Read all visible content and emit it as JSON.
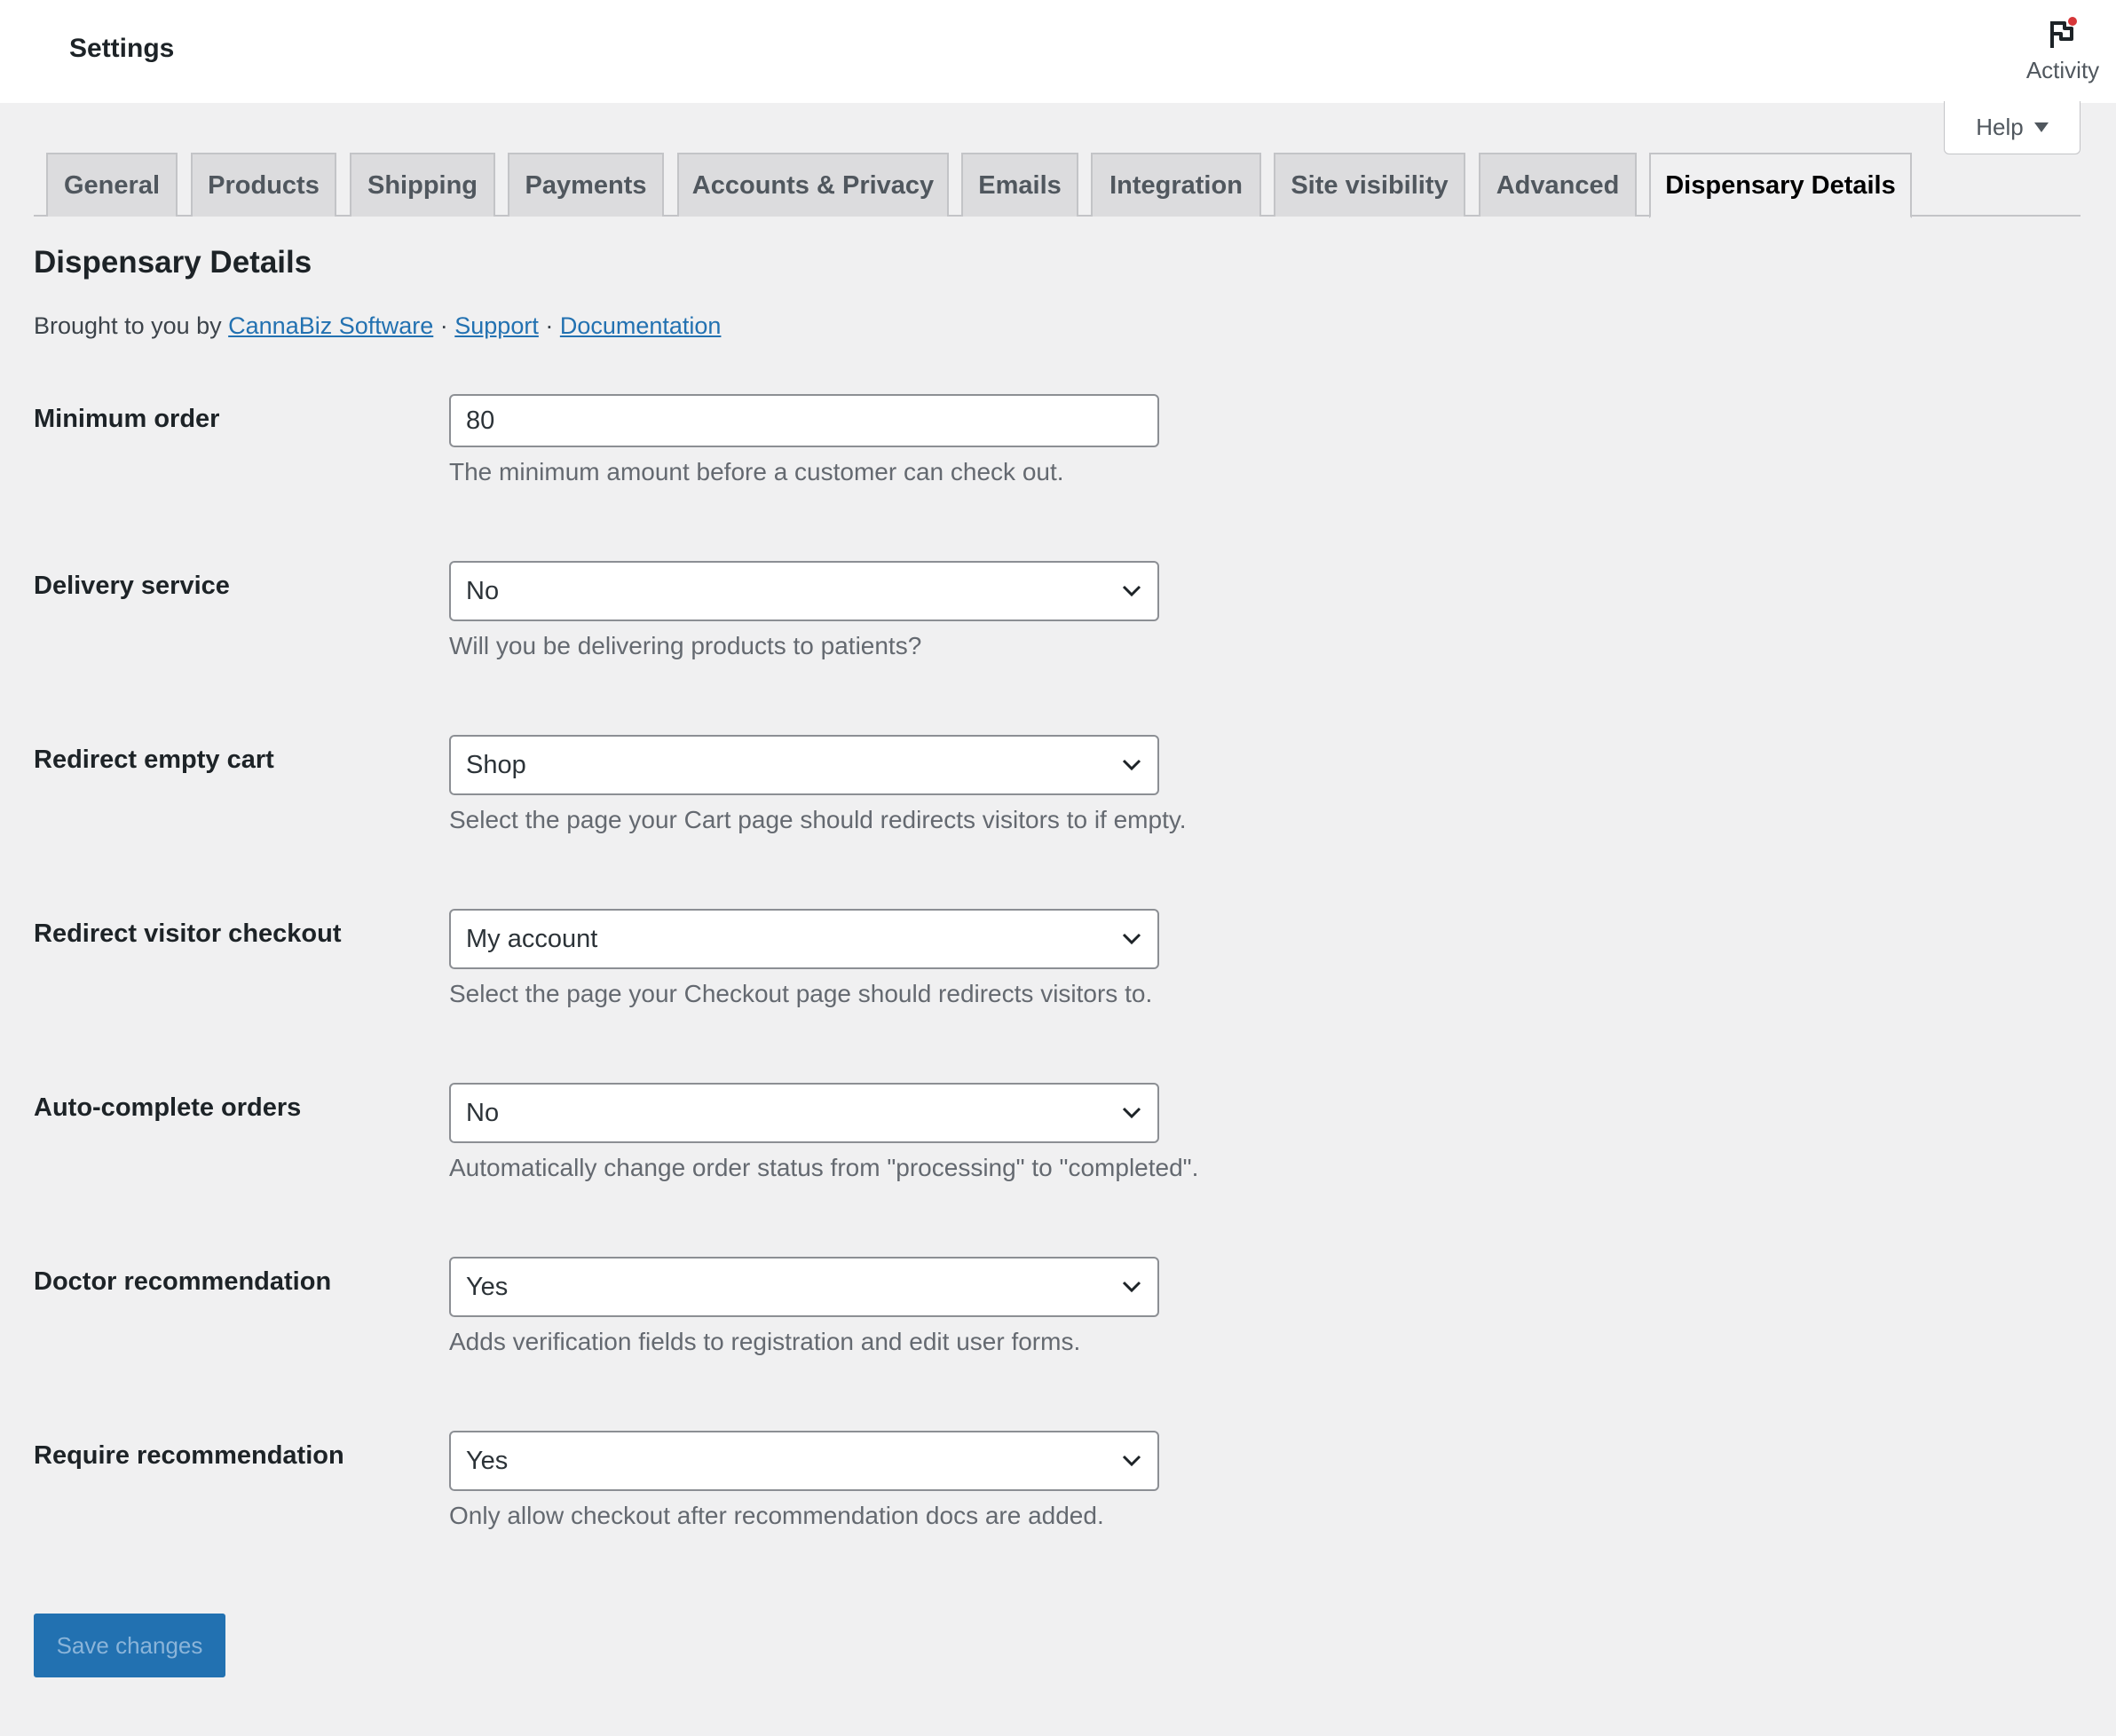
{
  "header": {
    "title": "Settings",
    "activity_label": "Activity",
    "help_label": "Help"
  },
  "tabs": [
    {
      "label": "General"
    },
    {
      "label": "Products"
    },
    {
      "label": "Shipping"
    },
    {
      "label": "Payments"
    },
    {
      "label": "Accounts & Privacy"
    },
    {
      "label": "Emails"
    },
    {
      "label": "Integration"
    },
    {
      "label": "Site visibility"
    },
    {
      "label": "Advanced"
    },
    {
      "label": "Dispensary Details",
      "active": true
    }
  ],
  "section": {
    "heading": "Dispensary Details",
    "byline_prefix": "Brought to you by ",
    "link_vendor": "CannaBiz Software",
    "link_support": "Support",
    "link_docs": "Documentation",
    "separator": " · "
  },
  "fields": [
    {
      "label": "Minimum order",
      "type": "input",
      "value": "80",
      "description": "The minimum amount before a customer can check out."
    },
    {
      "label": "Delivery service",
      "type": "select",
      "value": "No",
      "description": "Will you be delivering products to patients?"
    },
    {
      "label": "Redirect empty cart",
      "type": "select",
      "value": "Shop",
      "description": "Select the page your Cart page should redirects visitors to if empty."
    },
    {
      "label": "Redirect visitor checkout",
      "type": "select",
      "value": "My account",
      "description": "Select the page your Checkout page should redirects visitors to."
    },
    {
      "label": "Auto-complete orders",
      "type": "select",
      "value": "No",
      "description": "Automatically change order status from \"processing\" to \"completed\"."
    },
    {
      "label": "Doctor recommendation",
      "type": "select",
      "value": "Yes",
      "description": "Adds verification fields to registration and edit user forms."
    },
    {
      "label": "Require recommendation",
      "type": "select",
      "value": "Yes",
      "description": "Only allow checkout after recommendation docs are added."
    }
  ],
  "actions": {
    "save_label": "Save changes"
  },
  "colors": {
    "accent": "#2271b1",
    "background": "#f0f0f1",
    "notification_dot": "#d63638"
  },
  "icons": {
    "activity": "flag-icon",
    "help": "caret-down-icon",
    "select": "chevron-down-icon"
  }
}
